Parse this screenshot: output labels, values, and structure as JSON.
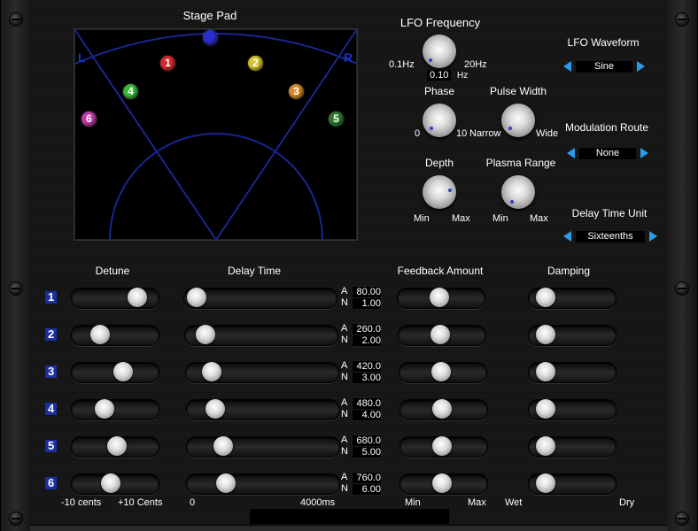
{
  "stage_pad": {
    "title": "Stage Pad",
    "left_label": "L",
    "right_label": "R",
    "sources": [
      {
        "label": "1",
        "color": "#d42b2b"
      },
      {
        "label": "2",
        "color": "#d4c42b"
      },
      {
        "label": "3",
        "color": "#d48a2b"
      },
      {
        "label": "4",
        "color": "#3ab83a"
      },
      {
        "label": "5",
        "color": "#2f7a2f"
      },
      {
        "label": "6",
        "color": "#c03aa8"
      }
    ]
  },
  "lfo": {
    "frequency": {
      "title": "LFO Frequency",
      "min": "0.1Hz",
      "max": "20Hz",
      "value": "0.10",
      "unit": "Hz"
    },
    "phase": {
      "title": "Phase",
      "min": "0",
      "max": "10"
    },
    "pulse_width": {
      "title": "Pulse Width",
      "min": "Narrow",
      "max": "Wide"
    },
    "depth": {
      "title": "Depth",
      "min": "Min",
      "max": "Max"
    },
    "plasma_range": {
      "title": "Plasma Range",
      "min": "Min",
      "max": "Max"
    }
  },
  "selectors": {
    "lfo_waveform": {
      "title": "LFO Waveform",
      "value": "Sine"
    },
    "modulation_route": {
      "title": "Modulation Route",
      "value": "None"
    },
    "delay_time_unit": {
      "title": "Delay Time Unit",
      "value": "Sixteenths"
    }
  },
  "columns": {
    "detune": "Detune",
    "delay_time": "Delay Time",
    "feedback": "Feedback Amount",
    "damping": "Damping"
  },
  "readout_labels": {
    "a": "A",
    "n": "N"
  },
  "rows": [
    {
      "num": "1",
      "detune": 0.83,
      "delay": 0.02,
      "a": "80.00",
      "n": "1.00",
      "feedback": 0.48,
      "damping": 0.1
    },
    {
      "num": "2",
      "detune": 0.28,
      "delay": 0.08,
      "a": "260.0",
      "n": "2.00",
      "feedback": 0.48,
      "damping": 0.1
    },
    {
      "num": "3",
      "detune": 0.62,
      "delay": 0.12,
      "a": "420.0",
      "n": "3.00",
      "feedback": 0.48,
      "damping": 0.1
    },
    {
      "num": "4",
      "detune": 0.34,
      "delay": 0.14,
      "a": "480.0",
      "n": "4.00",
      "feedback": 0.48,
      "damping": 0.1
    },
    {
      "num": "5",
      "detune": 0.52,
      "delay": 0.2,
      "a": "680.0",
      "n": "5.00",
      "feedback": 0.48,
      "damping": 0.1
    },
    {
      "num": "6",
      "detune": 0.43,
      "delay": 0.22,
      "a": "760.0",
      "n": "6.00",
      "feedback": 0.48,
      "damping": 0.1
    }
  ],
  "footer": {
    "detune_min": "-10 cents",
    "detune_max": "+10 Cents",
    "delay_min": "0",
    "delay_max": "4000ms",
    "feedback_min": "Min",
    "feedback_max": "Max",
    "damping_min": "Wet",
    "damping_max": "Dry"
  }
}
